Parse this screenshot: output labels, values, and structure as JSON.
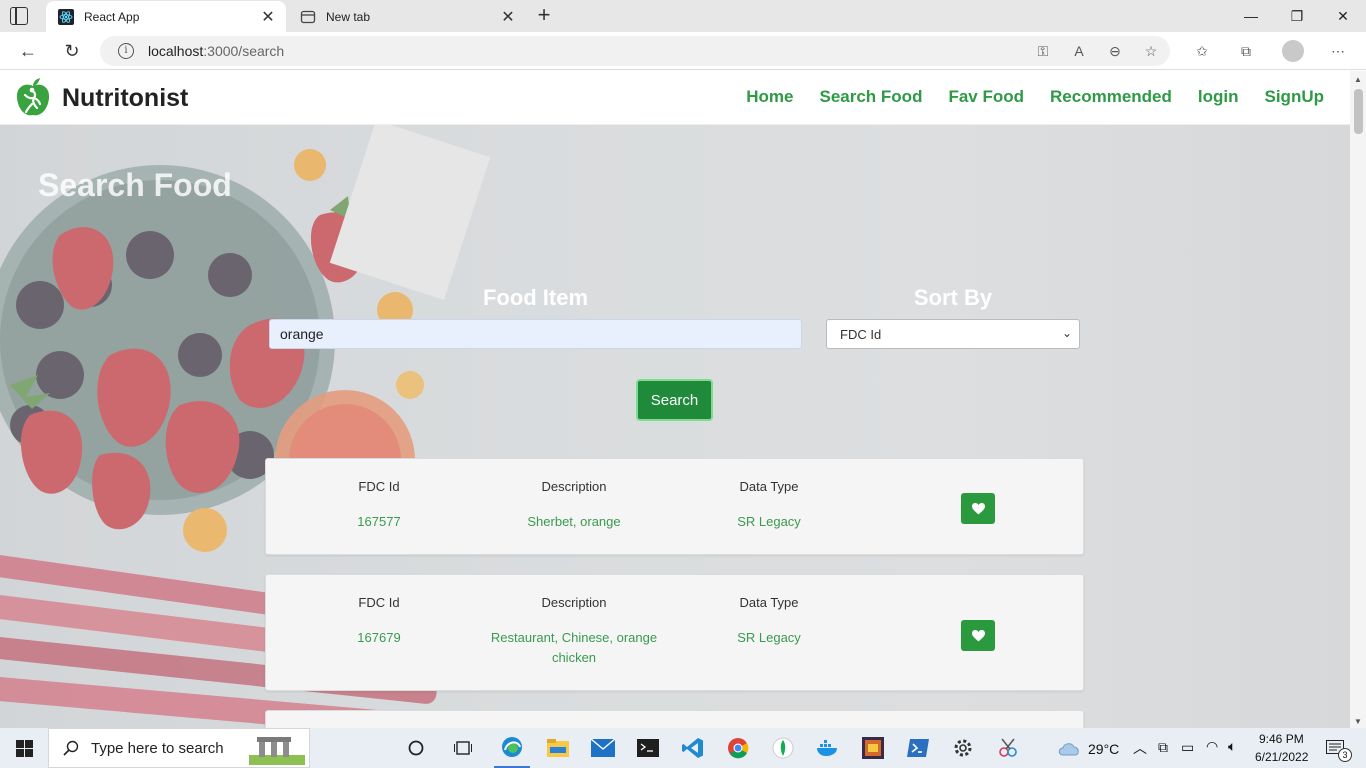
{
  "browser": {
    "tabs": [
      {
        "title": "React App",
        "active": true
      },
      {
        "title": "New tab",
        "active": false
      }
    ],
    "url": {
      "host": "localhost",
      "rest": ":3000/search"
    }
  },
  "app": {
    "brand": "Nutritonist",
    "nav": [
      "Home",
      "Search Food",
      "Fav Food",
      "Recommended",
      "login",
      "SignUp"
    ],
    "accent": "#2e9a46"
  },
  "search": {
    "page_title": "Search Food",
    "food_label": "Food Item",
    "food_value": "orange",
    "sort_label": "Sort By",
    "sort_value": "FDC Id",
    "button": "Search"
  },
  "results": [
    {
      "headers": {
        "fdc": "FDC Id",
        "desc": "Description",
        "type": "Data Type"
      },
      "fdc_id": "167577",
      "description": "Sherbet, orange",
      "data_type": "SR Legacy"
    },
    {
      "headers": {
        "fdc": "FDC Id",
        "desc": "Description",
        "type": "Data Type"
      },
      "fdc_id": "167679",
      "description": "Restaurant, Chinese, orange chicken",
      "data_type": "SR Legacy"
    }
  ],
  "taskbar": {
    "search_placeholder": "Type here to search",
    "temperature": "29°C",
    "time": "9:46 PM",
    "date": "6/21/2022",
    "notifications": "3"
  }
}
